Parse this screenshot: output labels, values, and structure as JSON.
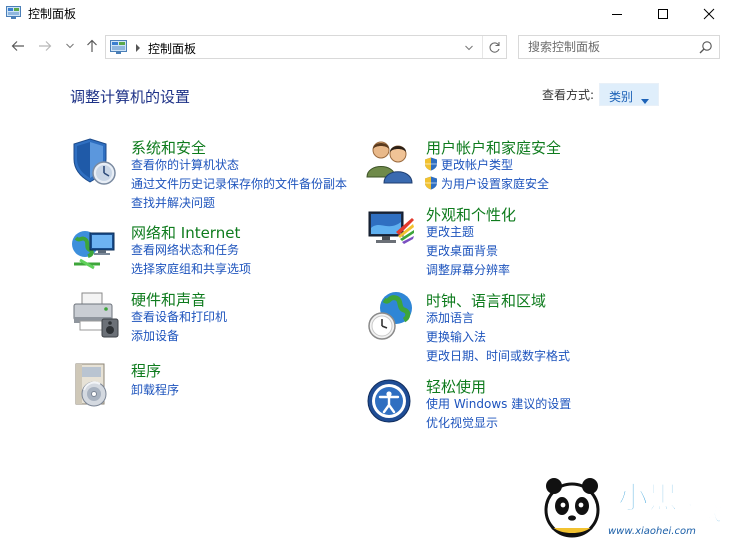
{
  "window": {
    "title": "控制面板"
  },
  "address": {
    "path": "控制面板"
  },
  "search": {
    "placeholder": "搜索控制面板"
  },
  "header": {
    "page_title": "调整计算机的设置",
    "view_by_label": "查看方式:",
    "view_by_value": "类别"
  },
  "categories": [
    {
      "title": "系统和安全",
      "icon": "system-security-icon",
      "links": [
        "查看你的计算机状态",
        "通过文件历史记录保存你的文件备份副本",
        "查找并解决问题"
      ]
    },
    {
      "title": "网络和 Internet",
      "icon": "network-internet-icon",
      "links": [
        "查看网络状态和任务",
        "选择家庭组和共享选项"
      ]
    },
    {
      "title": "硬件和声音",
      "icon": "hardware-sound-icon",
      "links": [
        "查看设备和打印机",
        "添加设备"
      ]
    },
    {
      "title": "程序",
      "icon": "programs-icon",
      "links": [
        "卸载程序"
      ]
    },
    {
      "title": "用户帐户和家庭安全",
      "icon": "user-accounts-icon",
      "links": [
        "更改帐户类型",
        "为用户设置家庭安全"
      ]
    },
    {
      "title": "外观和个性化",
      "icon": "appearance-icon",
      "links": [
        "更改主题",
        "更改桌面背景",
        "调整屏幕分辨率"
      ]
    },
    {
      "title": "时钟、语言和区域",
      "icon": "clock-language-icon",
      "links": [
        "添加语言",
        "更换输入法",
        "更改日期、时间或数字格式"
      ]
    },
    {
      "title": "轻松使用",
      "icon": "ease-of-access-icon",
      "links": [
        "使用 Windows 建议的设置",
        "优化视觉显示"
      ]
    }
  ],
  "watermark": {
    "brand": "小黑游戏",
    "url": "www.xiaohei.com"
  },
  "colors": {
    "category_title": "#0e7b1d",
    "link": "#1e54bd",
    "page_title": "#1e3287",
    "view_by_bg": "#dfeefb"
  }
}
